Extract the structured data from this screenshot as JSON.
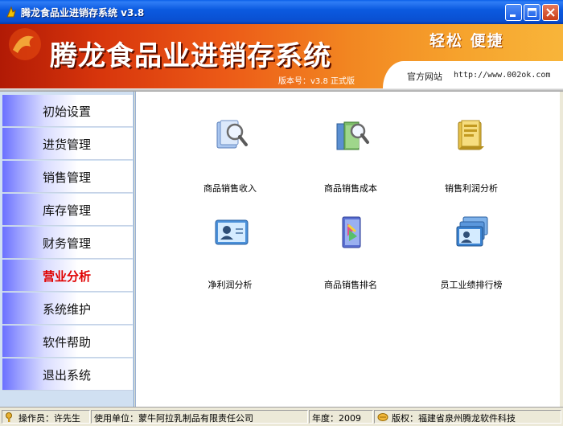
{
  "window": {
    "title": "腾龙食品业进销存系统 v3.8"
  },
  "banner": {
    "title": "腾龙食品业进销存系统",
    "version": "版本号：v3.8 正式版",
    "slogan": "轻松  便捷",
    "site_label": "官方网站",
    "site_url": "http://www.002ok.com"
  },
  "sidebar": {
    "items": [
      {
        "label": "初始设置",
        "active": false
      },
      {
        "label": "进货管理",
        "active": false
      },
      {
        "label": "销售管理",
        "active": false
      },
      {
        "label": "库存管理",
        "active": false
      },
      {
        "label": "财务管理",
        "active": false
      },
      {
        "label": "营业分析",
        "active": true
      },
      {
        "label": "系统维护",
        "active": false
      },
      {
        "label": "软件帮助",
        "active": false
      },
      {
        "label": "退出系统",
        "active": false
      }
    ]
  },
  "main": {
    "tiles": [
      {
        "label": "商品销售收入",
        "icon": "magnifier-document-icon"
      },
      {
        "label": "商品销售成本",
        "icon": "magnifier-folder-icon"
      },
      {
        "label": "销售利润分析",
        "icon": "folder-icon"
      },
      {
        "label": "净利润分析",
        "icon": "user-card-icon"
      },
      {
        "label": "商品销售排名",
        "icon": "book-icon"
      },
      {
        "label": "员工业绩排行榜",
        "icon": "user-cards-stack-icon"
      }
    ]
  },
  "status": {
    "operator": "操作员：许先生",
    "unit": "使用单位：蒙牛阿拉乳制品有限责任公司",
    "year": "年度：2009",
    "copyright": "版权：福建省泉州腾龙软件科技"
  },
  "colors": {
    "titlebar": "#0a4fd0",
    "banner_start": "#b11a05",
    "banner_end": "#f8b53a",
    "active_nav": "#e00000"
  }
}
